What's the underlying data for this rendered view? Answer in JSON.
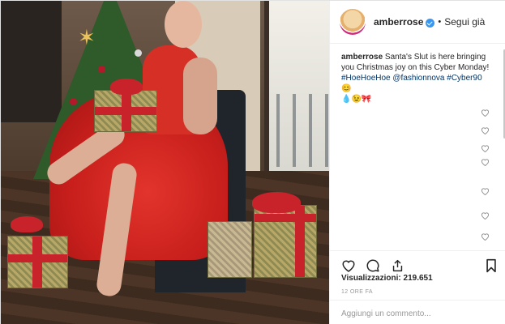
{
  "post": {
    "username": "amberrose",
    "follow_separator": "•",
    "follow_label": "Segui già",
    "caption": {
      "author": "amberrose",
      "text": "Santa's Slut is here bringing you Christmas joy on this Cyber Monday!",
      "tags": [
        "#HoeHoeHoe",
        "@fashionnova",
        "#Cyber90"
      ],
      "tags_emoji": "😊",
      "emoji_line": "💧😉🎀"
    },
    "views_label": "Visualizzazioni:",
    "views_count": "219.651",
    "time_ago": "12 ORE FA",
    "add_comment_placeholder": "Aggiungi un commento...",
    "comment_like_icon_count": 7,
    "icons": [
      "heart-icon",
      "comment-icon",
      "share-icon",
      "bookmark-icon",
      "verified-badge-icon"
    ],
    "colors": {
      "verified": "#3897f0",
      "link": "#003569",
      "text": "#262626",
      "muted": "#999999"
    }
  }
}
